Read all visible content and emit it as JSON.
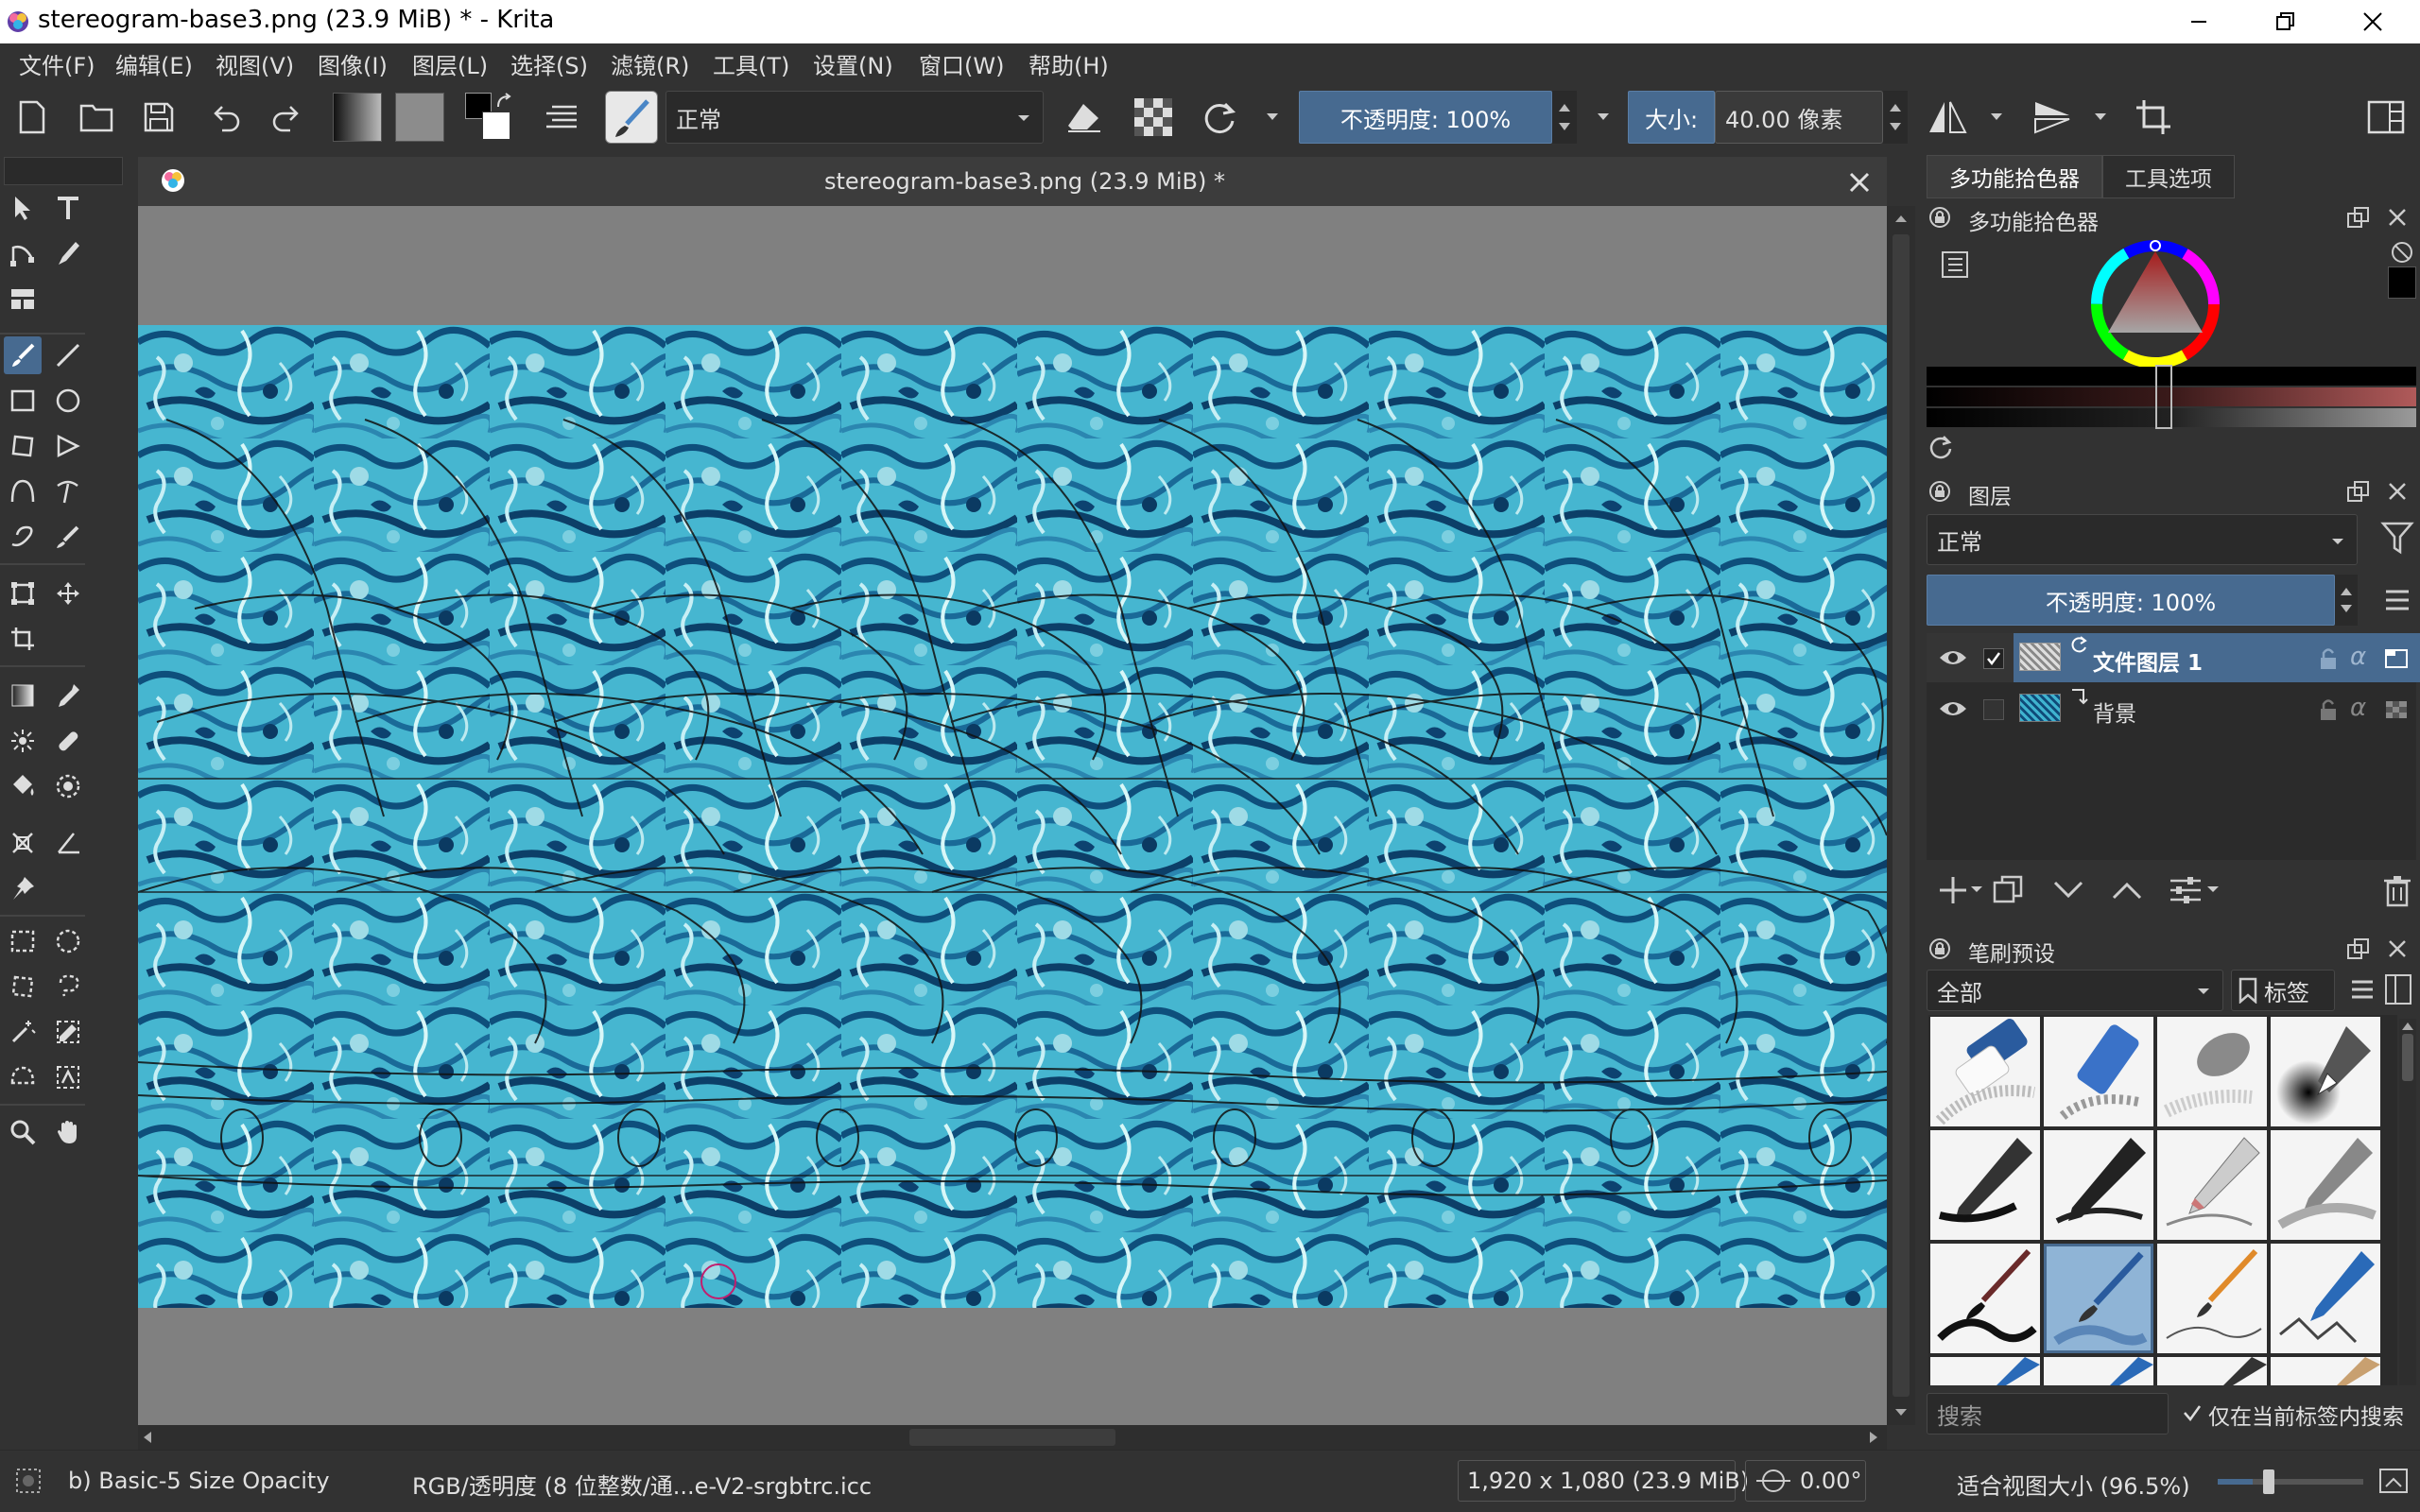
{
  "window": {
    "title": "stereogram-base3.png (23.9 MiB) * - Krita"
  },
  "menu": [
    "文件(F)",
    "编辑(E)",
    "视图(V)",
    "图像(I)",
    "图层(L)",
    "选择(S)",
    "滤镜(R)",
    "工具(T)",
    "设置(N)",
    "窗口(W)",
    "帮助(H)"
  ],
  "toolbar": {
    "blend_mode": "正常",
    "opacity_label": "不透明度: 100%",
    "size_prefix": "大小:",
    "size_value": "40.00 像素"
  },
  "document": {
    "tab_title": "stereogram-base3.png (23.9 MiB) *"
  },
  "docker_tabs": {
    "color_tab": "多功能拾色器",
    "tool_options_tab": "工具选项"
  },
  "color_docker": {
    "title": "多功能拾色器"
  },
  "layers_docker": {
    "title": "图层",
    "blend_mode": "正常",
    "opacity_label": "不透明度: 100%",
    "layers": [
      {
        "name": "文件图层 1",
        "selected": true
      },
      {
        "name": "背景",
        "selected": false
      }
    ]
  },
  "brush_docker": {
    "title": "笔刷预设",
    "filter_all": "全部",
    "tag_label": "标签",
    "search_placeholder": "搜索",
    "only_current_tag": "仅在当前标签内搜索"
  },
  "statusbar": {
    "brush_name": "b) Basic-5 Size Opacity",
    "color_profile": "RGB/透明度 (8 位整数/通...e-V2-srgbtrc.icc",
    "dimensions": "1,920 x 1,080 (23.9 MiB)",
    "rotation": "0.00°",
    "zoom": "适合视图大小 (96.5%)"
  },
  "colors": {
    "selection_blue": "#476a90",
    "bg_dark": "#323232",
    "canvas_bg": "#808080",
    "pattern_cyan": "#3fb3cf",
    "pattern_navy": "#0f4a78"
  }
}
